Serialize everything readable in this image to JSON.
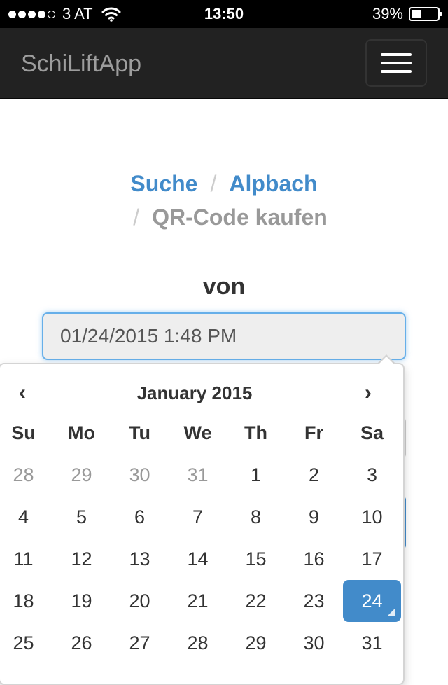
{
  "status_bar": {
    "carrier": "3 AT",
    "time": "13:50",
    "battery_percent": "39%",
    "battery_level": 0.39,
    "signal_bars_filled": 4,
    "signal_bars_total": 5,
    "wifi_icon": "wifi-icon"
  },
  "navbar": {
    "brand": "SchiLiftApp",
    "menu_icon": "hamburger-menu-icon"
  },
  "breadcrumb": {
    "items": [
      "Suche",
      "Alpbach",
      "QR-Code kaufen"
    ],
    "separator": "/"
  },
  "form": {
    "from_label": "von",
    "from_value": "01/24/2015 1:48 PM"
  },
  "datepicker": {
    "title": "January 2015",
    "prev": "‹",
    "next": "›",
    "weekdays": [
      "Su",
      "Mo",
      "Tu",
      "We",
      "Th",
      "Fr",
      "Sa"
    ],
    "weeks": [
      [
        "28",
        "29",
        "30",
        "31",
        "1",
        "2",
        "3"
      ],
      [
        "4",
        "5",
        "6",
        "7",
        "8",
        "9",
        "10"
      ],
      [
        "11",
        "12",
        "13",
        "14",
        "15",
        "16",
        "17"
      ],
      [
        "18",
        "19",
        "20",
        "21",
        "22",
        "23",
        "24"
      ],
      [
        "25",
        "26",
        "27",
        "28",
        "29",
        "30",
        "31"
      ]
    ],
    "selected_day": "24",
    "colors": {
      "accent": "#428bca",
      "muted": "#999999"
    }
  }
}
